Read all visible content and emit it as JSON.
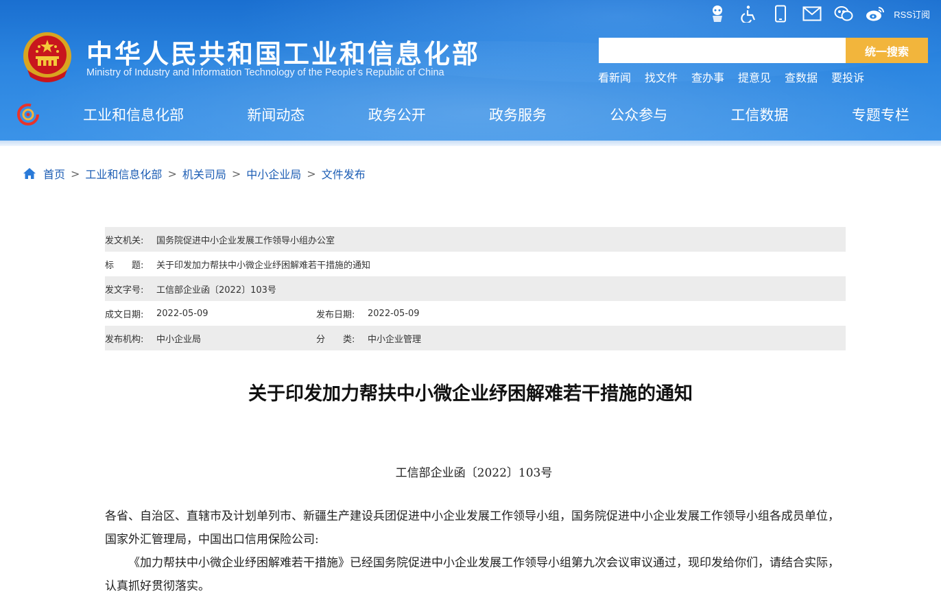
{
  "site": {
    "title_cn": "中华人民共和国工业和信息化部",
    "title_en": "Ministry of Industry and Information Technology of the People's Republic of China"
  },
  "top_icons": [
    {
      "icon": "robot-assistant-icon"
    },
    {
      "icon": "accessibility-icon"
    },
    {
      "icon": "mobile-phone-icon"
    },
    {
      "icon": "mail-icon"
    },
    {
      "icon": "wechat-icon"
    },
    {
      "icon": "weibo-icon"
    }
  ],
  "rss_label": "RSS订阅",
  "search": {
    "placeholder": "",
    "button_label": "统一搜索"
  },
  "quick_links": [
    "看新闻",
    "找文件",
    "查办事",
    "提意见",
    "查数据",
    "要投诉"
  ],
  "nav": [
    "工业和信息化部",
    "新闻动态",
    "政务公开",
    "政务服务",
    "公众参与",
    "工信数据",
    "专题专栏"
  ],
  "breadcrumb": [
    "首页",
    "工业和信息化部",
    "机关司局",
    "中小企业局",
    "文件发布"
  ],
  "meta": {
    "issuer_label": "发文机关:",
    "issuer": "国务院促进中小企业发展工作领导小组办公室",
    "title_label": "标　　题:",
    "title": "关于印发加力帮扶中小微企业纾困解难若干措施的通知",
    "doc_no_label": "发文字号:",
    "doc_no": "工信部企业函〔2022〕103号",
    "written_date_label": "成文日期:",
    "written_date": "2022-05-09",
    "publish_date_label": "发布日期:",
    "publish_date": "2022-05-09",
    "publisher_label": "发布机构:",
    "publisher": "中小企业局",
    "category_label": "分　　类:",
    "category": "中小企业管理"
  },
  "article": {
    "title": "关于印发加力帮扶中小微企业纾困解难若干措施的通知",
    "doc_number": "工信部企业函〔2022〕103号",
    "paragraphs": [
      "各省、自治区、直辖市及计划单列市、新疆生产建设兵团促进中小企业发展工作领导小组，国务院促进中小企业发展工作领导小组各成员单位，国家外汇管理局，中国出口信用保险公司:",
      "《加力帮扶中小微企业纾困解难若干措施》已经国务院促进中小企业发展工作领导小组第九次会议审议通过，现印发给你们，请结合实际，认真抓好贯彻落实。"
    ]
  },
  "colors": {
    "header_blue": "#2b85e0",
    "search_button": "#f2b53c",
    "link_blue": "#1c5db4",
    "meta_shade": "#ececec"
  }
}
